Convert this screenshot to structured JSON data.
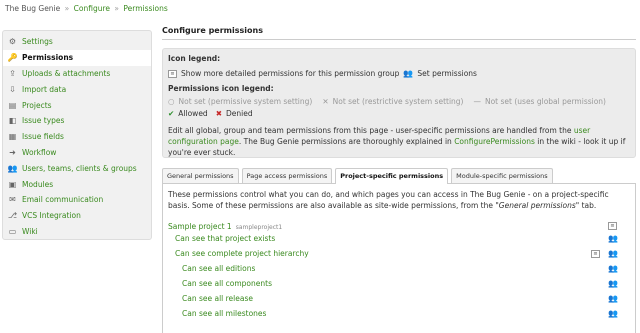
{
  "breadcrumb": {
    "app": "The Bug Genie",
    "sep": "»",
    "configure": "Configure",
    "permissions": "Permissions"
  },
  "sidebar": {
    "items": [
      {
        "label": "Settings",
        "icon": "gear-icon"
      },
      {
        "label": "Permissions",
        "icon": "key-icon",
        "active": true
      },
      {
        "label": "Uploads & attachments",
        "icon": "upload-icon"
      },
      {
        "label": "Import data",
        "icon": "import-icon"
      },
      {
        "label": "Projects",
        "icon": "folder-icon"
      },
      {
        "label": "Issue types",
        "icon": "issue-type-icon"
      },
      {
        "label": "Issue fields",
        "icon": "issue-field-icon"
      },
      {
        "label": "Workflow",
        "icon": "workflow-icon"
      },
      {
        "label": "Users, teams, clients & groups",
        "icon": "users-icon"
      },
      {
        "label": "Modules",
        "icon": "module-icon"
      },
      {
        "label": "Email communication",
        "icon": "email-icon"
      },
      {
        "label": "VCS Integration",
        "icon": "vcs-icon"
      },
      {
        "label": "Wiki",
        "icon": "wiki-icon"
      }
    ]
  },
  "main": {
    "title": "Configure permissions",
    "icon_legend_title": "Icon legend:",
    "icon_legend_detail": "Show more detailed permissions for this permission group",
    "icon_legend_set": "Set permissions",
    "perm_legend_title": "Permissions icon legend:",
    "not_set_permissive": "Not set (permissive system setting)",
    "not_set_restrictive": "Not set (restrictive system setting)",
    "not_set_global": "Not set (uses global permission)",
    "allowed": "Allowed",
    "denied": "Denied",
    "para_a": "Edit all global, group and team permissions from this page - user-specific permissions are handled from the ",
    "para_link1": "user configuration page",
    "para_b": ". The Bug Genie permissions are thoroughly explained in ",
    "para_link2": "ConfigurePermissions",
    "para_c": " in the wiki - look it up if you're ever stuck.",
    "tabs": [
      {
        "label": "General permissions"
      },
      {
        "label": "Page access permissions"
      },
      {
        "label": "Project-specific permissions",
        "active": true
      },
      {
        "label": "Module-specific permissions"
      }
    ],
    "intro_a": "These permissions control what you can do, and which pages you can access in The Bug Genie - on a project-specific basis. Some of these permissions are also available as site-wide permissions, from the \"",
    "intro_em": "General permissions",
    "intro_b": "\" tab.",
    "project_name": "Sample project 1",
    "project_key": "sampleproject1",
    "perms": [
      {
        "label": "Can see that project exists",
        "sub": false,
        "detail": false
      },
      {
        "label": "Can see complete project hierarchy",
        "sub": false,
        "detail": true
      },
      {
        "label": "Can see all editions",
        "sub": true,
        "detail": false
      },
      {
        "label": "Can see all components",
        "sub": true,
        "detail": false
      },
      {
        "label": "Can see all release",
        "sub": true,
        "detail": false
      },
      {
        "label": "Can see all milestones",
        "sub": true,
        "detail": false
      }
    ]
  },
  "colors": {
    "accent": "#3a8a1f",
    "sidebar_bg": "#f1f1f1",
    "legend_bg": "#ececec",
    "denied": "#c62828"
  }
}
